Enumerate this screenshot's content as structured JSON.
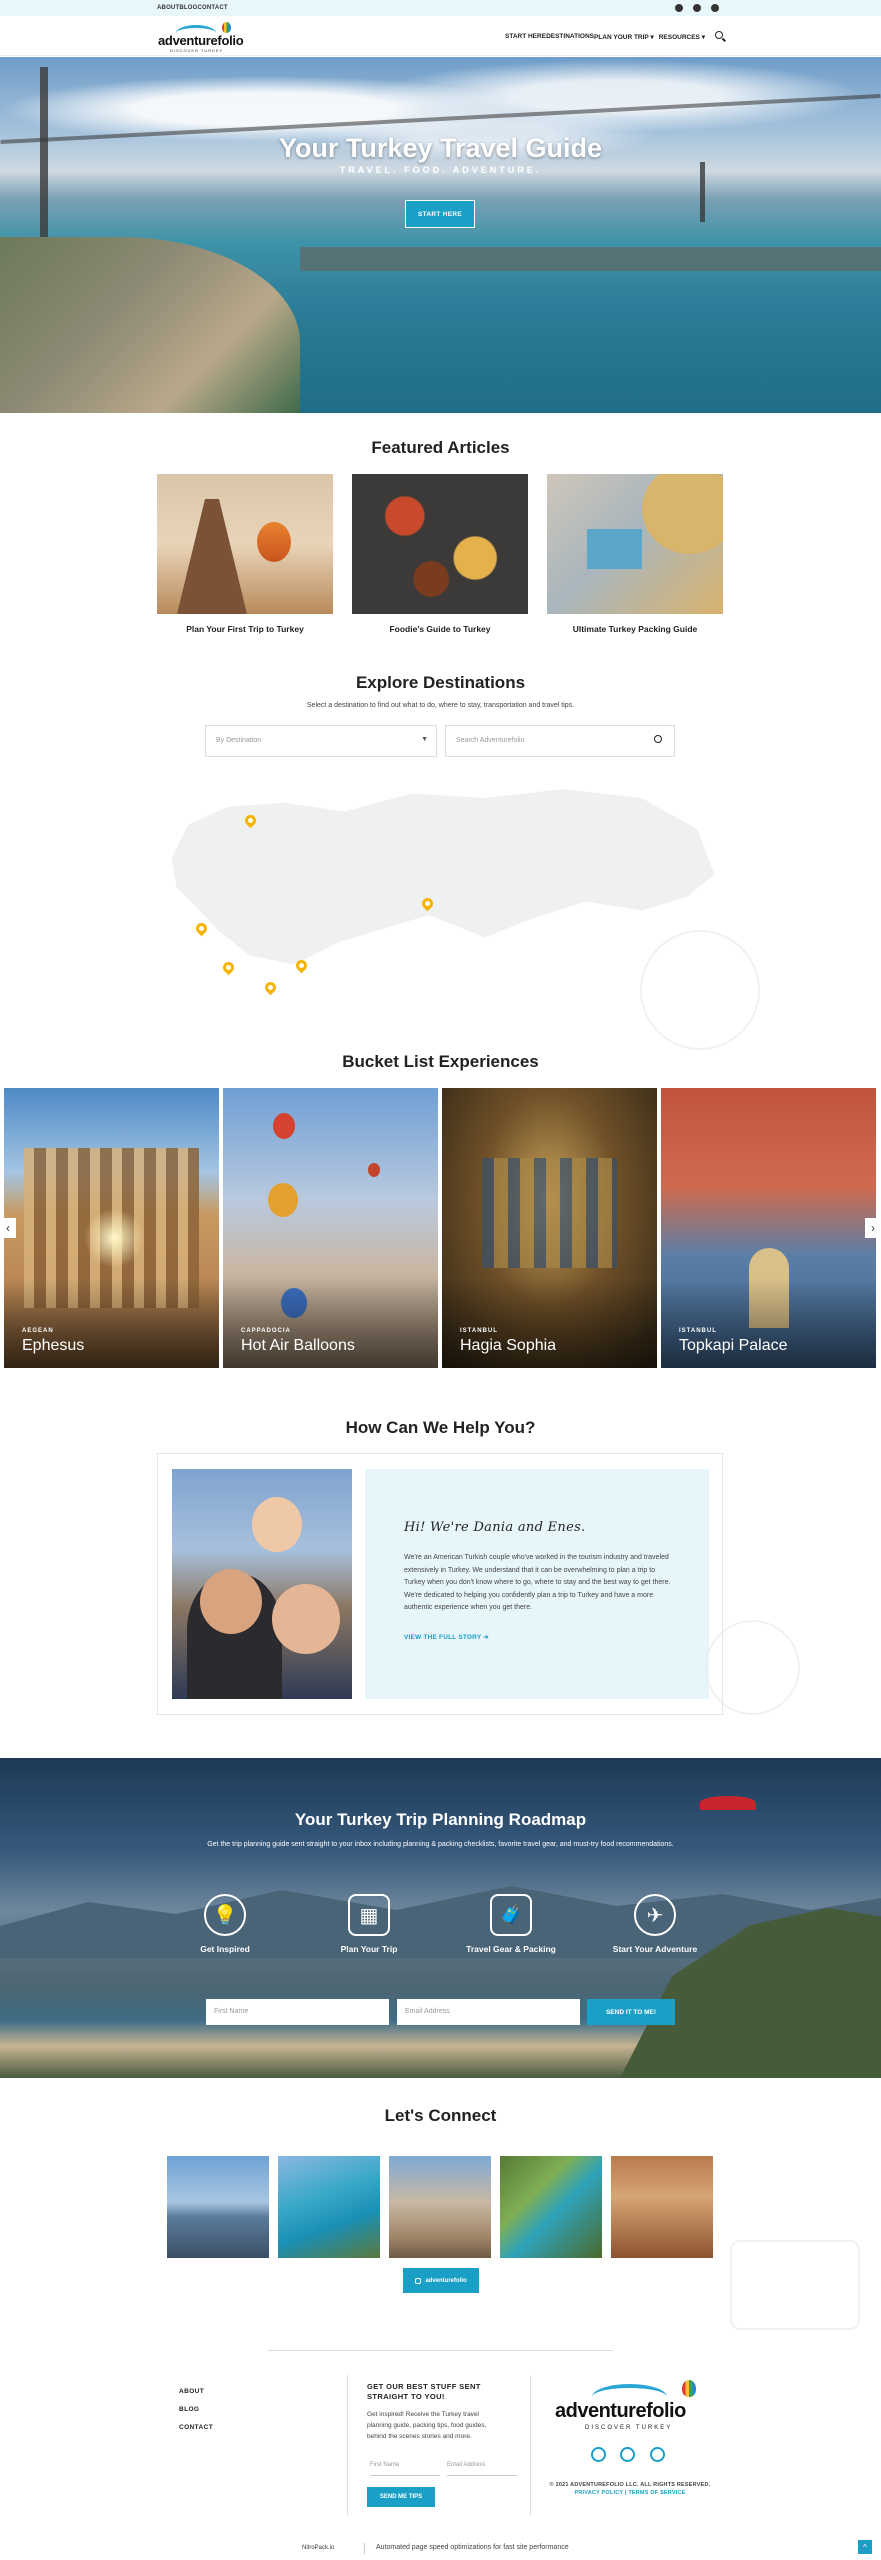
{
  "topbar": {
    "links": [
      "ABOUT",
      "BLOG",
      "CONTACT"
    ],
    "social": [
      "instagram-icon",
      "facebook-icon",
      "pinterest-icon"
    ]
  },
  "brand": {
    "name": "adventurefolio",
    "tagline": "DISCOVER TURKEY"
  },
  "nav": {
    "items": [
      "START HERE",
      "DESTINATIONS",
      "PLAN YOUR TRIP ▾",
      "RESOURCES ▾"
    ]
  },
  "hero": {
    "title": "Your Turkey Travel Guide",
    "subtitle": "TRAVEL. FOOD. ADVENTURE.",
    "button": "START HERE"
  },
  "featured": {
    "heading": "Featured Articles",
    "articles": [
      "Plan Your First Trip to Turkey",
      "Foodie's Guide to Turkey",
      "Ultimate Turkey Packing Guide"
    ]
  },
  "destinations": {
    "heading": "Explore Destinations",
    "subtext": "Select a destination to find out what to do, where to stay, transportation and travel tips.",
    "select_label": "By Destination",
    "search_placeholder": "Search Adventurefolio"
  },
  "bucket": {
    "heading": "Bucket List Experiences",
    "cards": [
      {
        "region": "AEGEAN",
        "name": "Ephesus"
      },
      {
        "region": "CAPPADOCIA",
        "name": "Hot Air Balloons"
      },
      {
        "region": "ISTANBUL",
        "name": "Hagia Sophia"
      },
      {
        "region": "ISTANBUL",
        "name": "Topkapi Palace"
      }
    ]
  },
  "help": {
    "heading": "How Can We Help You?",
    "greeting": "Hi! We're Dania and Enes.",
    "body": "We're an American Turkish couple who've worked in the tourism industry and traveled extensively in Turkey. We understand that it can be overwhelming to plan a trip to Turkey when you don't know where to go, where to stay and the best way to get there. We're dedicated to helping you confidently plan a trip to Turkey and have a more authentic experience when you get there.",
    "link": "VIEW THE FULL STORY ➔"
  },
  "roadmap": {
    "heading": "Your Turkey Trip Planning Roadmap",
    "subtext": "Get the trip planning guide sent straight to your inbox including planning & packing checklists, favorite travel gear, and must-try food recommendations.",
    "steps": [
      "Get Inspired",
      "Plan Your Trip",
      "Travel Gear & Packing",
      "Start Your Adventure"
    ],
    "first_name_placeholder": "First Name",
    "email_placeholder": "Email Address",
    "button": "SEND IT TO ME!"
  },
  "connect": {
    "heading": "Let's Connect",
    "instagram_button": "adventurefolio"
  },
  "footer": {
    "links": [
      "ABOUT",
      "BLOG",
      "CONTACT"
    ],
    "signup_heading": "GET OUR BEST STUFF SENT STRAIGHT TO YOU!",
    "signup_text": "Get inspired! Receive the Turkey travel planning guide, packing tips, food guides, behind the scenes stories and more.",
    "first_name": "First Name",
    "email": "Email Address",
    "button": "SEND ME TIPS",
    "copyright": "© 2021 ADVENTUREFOLIO LLC. ALL RIGHTS RESERVED.",
    "policy": "PRIVACY POLICY | TERMS OF SERVICE"
  },
  "bottombar": {
    "badge": "NitroPack.io",
    "text": "Automated page speed optimizations for fast site performance"
  },
  "colors": {
    "accent": "#1aa0c6",
    "topbar": "#e8f7fb",
    "panel": "#e6f6fb",
    "pin": "#f5b400"
  }
}
